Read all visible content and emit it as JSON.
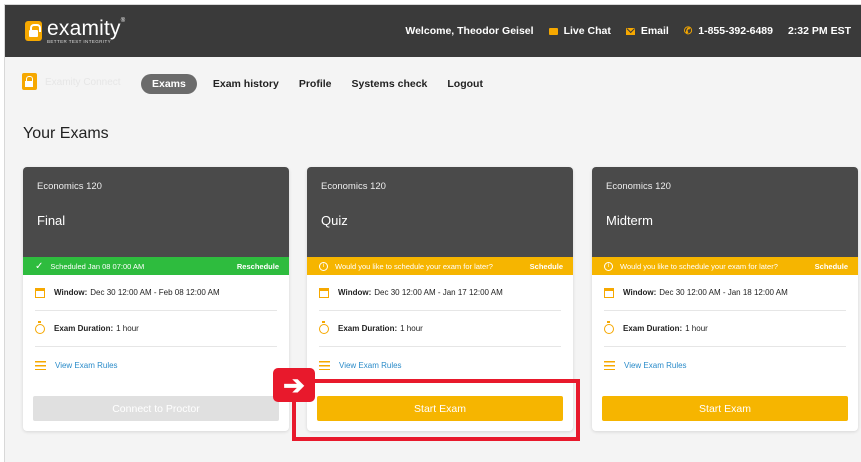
{
  "brand": {
    "name": "examity",
    "trademark": "®",
    "tagline": "BETTER TEST INTEGRITY"
  },
  "header": {
    "welcome": "Welcome, Theodor Geisel",
    "live_chat": "Live Chat",
    "email": "Email",
    "phone": "1-855-392-6489",
    "time": "2:32 PM  EST",
    "accent_color": "#f6a800"
  },
  "nav": {
    "faded_label": "Examity Connect",
    "items": [
      "Exams",
      "Exam history",
      "Profile",
      "Systems check",
      "Logout"
    ],
    "active": "Exams"
  },
  "page_title": "Your Exams",
  "cards": [
    {
      "course": "Economics 120",
      "title": "Final",
      "status": {
        "type": "scheduled",
        "message": "Scheduled Jan 08 07:00 AM",
        "action": "Reschedule",
        "color": "#2ebc3e"
      },
      "window_label": "Window:",
      "window": "Dec 30 12:00 AM - Feb 08 12:00 AM",
      "duration_label": "Exam Duration:",
      "duration": "1 hour",
      "rules_link": "View Exam Rules",
      "button": {
        "label": "Connect to Proctor",
        "enabled": false
      }
    },
    {
      "course": "Economics 120",
      "title": "Quiz",
      "status": {
        "type": "prompt",
        "message": "Would you like to schedule your exam for later?",
        "action": "Schedule",
        "color": "#f6b500"
      },
      "window_label": "Window:",
      "window": "Dec 30 12:00 AM - Jan 17 12:00 AM",
      "duration_label": "Exam Duration:",
      "duration": "1 hour",
      "rules_link": "View Exam Rules",
      "button": {
        "label": "Start Exam",
        "enabled": true
      }
    },
    {
      "course": "Economics 120",
      "title": "Midterm",
      "status": {
        "type": "prompt",
        "message": "Would you like to schedule your exam for later?",
        "action": "Schedule",
        "color": "#f6b500"
      },
      "window_label": "Window:",
      "window": "Dec 30 12:00 AM - Jan 18 12:00 AM",
      "duration_label": "Exam Duration:",
      "duration": "1 hour",
      "rules_link": "View Exam Rules",
      "button": {
        "label": "Start Exam",
        "enabled": true
      }
    }
  ],
  "annotation": {
    "arrow_glyph": "➔",
    "highlight_color": "#e8192c"
  }
}
